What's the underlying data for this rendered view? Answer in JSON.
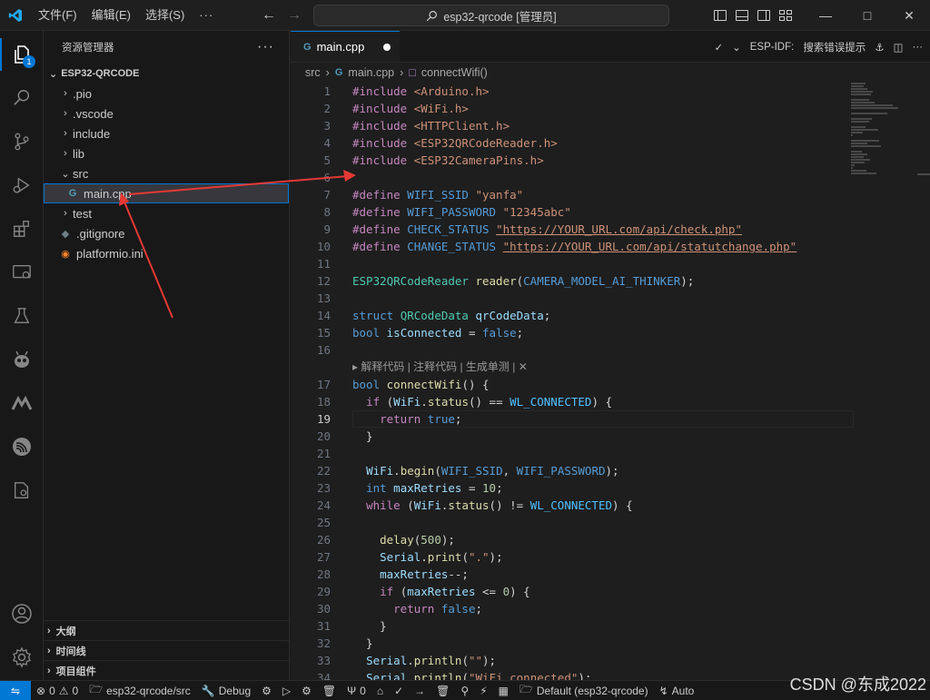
{
  "titlebar": {
    "menus": [
      "文件(F)",
      "编辑(E)",
      "选择(S)",
      "···"
    ],
    "command_center": "esp32-qrcode [管理员]"
  },
  "activitybar": {
    "explorer_badge": "1",
    "accent_color": "#0078d4"
  },
  "sidebar": {
    "title": "资源管理器",
    "project": "ESP32-QRCODE",
    "items": [
      {
        "label": ".pio",
        "type": "folder",
        "expanded": false
      },
      {
        "label": ".vscode",
        "type": "folder",
        "expanded": false
      },
      {
        "label": "include",
        "type": "folder",
        "expanded": false
      },
      {
        "label": "lib",
        "type": "folder",
        "expanded": false
      },
      {
        "label": "src",
        "type": "folder",
        "expanded": true
      },
      {
        "label": "main.cpp",
        "type": "cpp",
        "selected": true
      },
      {
        "label": "test",
        "type": "folder",
        "expanded": false
      },
      {
        "label": ".gitignore",
        "type": "git"
      },
      {
        "label": "platformio.ini",
        "type": "pio"
      }
    ],
    "bottom_sections": [
      "大纲",
      "时间线",
      "项目组件"
    ]
  },
  "editor": {
    "tab_label": "main.cpp",
    "actions_label": "ESP-IDF:",
    "actions_search": "搜索错误提示",
    "breadcrumb": [
      "src",
      "main.cpp",
      "connectWifi()"
    ],
    "codelens": "解释代码 | 注释代码 | 生成单测 | ✕",
    "current_line": 19
  },
  "code": [
    {
      "n": 1,
      "t": [
        [
          "k-pre",
          "#include "
        ],
        [
          "k-str",
          "<Arduino.h>"
        ]
      ]
    },
    {
      "n": 2,
      "t": [
        [
          "k-pre",
          "#include "
        ],
        [
          "k-str",
          "<WiFi.h>"
        ]
      ]
    },
    {
      "n": 3,
      "t": [
        [
          "k-pre",
          "#include "
        ],
        [
          "k-str",
          "<HTTPClient.h>"
        ]
      ]
    },
    {
      "n": 4,
      "t": [
        [
          "k-pre",
          "#include "
        ],
        [
          "k-str",
          "<ESP32QRCodeReader.h>"
        ]
      ]
    },
    {
      "n": 5,
      "t": [
        [
          "k-pre",
          "#include "
        ],
        [
          "k-str",
          "<ESP32CameraPins.h>"
        ]
      ]
    },
    {
      "n": 6,
      "t": []
    },
    {
      "n": 7,
      "t": [
        [
          "k-pre",
          "#define "
        ],
        [
          "k-mac",
          "WIFI_SSID "
        ],
        [
          "k-str",
          "\"yanfa\""
        ]
      ]
    },
    {
      "n": 8,
      "t": [
        [
          "k-pre",
          "#define "
        ],
        [
          "k-mac",
          "WIFI_PASSWORD "
        ],
        [
          "k-str",
          "\"12345abc\""
        ]
      ]
    },
    {
      "n": 9,
      "t": [
        [
          "k-pre",
          "#define "
        ],
        [
          "k-mac",
          "CHECK_STATUS "
        ],
        [
          "k-str",
          "\"https://YOUR_URL.com/api/check.php\""
        ]
      ]
    },
    {
      "n": 10,
      "t": [
        [
          "k-pre",
          "#define "
        ],
        [
          "k-mac",
          "CHANGE_STATUS "
        ],
        [
          "k-str",
          "\"https://YOUR_URL.com/api/statutchange.php\""
        ]
      ]
    },
    {
      "n": 11,
      "t": []
    },
    {
      "n": 12,
      "t": [
        [
          "k-ty",
          "ESP32QRCodeReader "
        ],
        [
          "k-fn",
          "reader"
        ],
        [
          "k-plain",
          "("
        ],
        [
          "k-mac",
          "CAMERA_MODEL_AI_THINKER"
        ],
        [
          "k-plain",
          ");"
        ]
      ]
    },
    {
      "n": 13,
      "t": []
    },
    {
      "n": 14,
      "t": [
        [
          "k-kw",
          "struct "
        ],
        [
          "k-ty",
          "QRCodeData "
        ],
        [
          "k-var",
          "qrCodeData"
        ],
        [
          "k-plain",
          ";"
        ]
      ]
    },
    {
      "n": 15,
      "t": [
        [
          "k-kw",
          "bool "
        ],
        [
          "k-var",
          "isConnected "
        ],
        [
          "k-plain",
          "= "
        ],
        [
          "k-kw",
          "false"
        ],
        [
          "k-plain",
          ";"
        ]
      ]
    },
    {
      "n": 16,
      "t": []
    },
    {
      "n": 17,
      "t": [
        [
          "k-kw",
          "bool "
        ],
        [
          "k-fn",
          "connectWifi"
        ],
        [
          "k-plain",
          "() {"
        ]
      ]
    },
    {
      "n": 18,
      "t": [
        [
          "k-plain",
          "  "
        ],
        [
          "k-pre",
          "if "
        ],
        [
          "k-plain",
          "("
        ],
        [
          "k-var",
          "WiFi"
        ],
        [
          "k-plain",
          "."
        ],
        [
          "k-fn",
          "status"
        ],
        [
          "k-plain",
          "() == "
        ],
        [
          "k-con",
          "WL_CONNECTED"
        ],
        [
          "k-plain",
          ") {"
        ]
      ]
    },
    {
      "n": 19,
      "t": [
        [
          "k-plain",
          "    "
        ],
        [
          "k-pre",
          "return "
        ],
        [
          "k-kw",
          "true"
        ],
        [
          "k-plain",
          ";"
        ]
      ]
    },
    {
      "n": 20,
      "t": [
        [
          "k-plain",
          "  }"
        ]
      ]
    },
    {
      "n": 21,
      "t": []
    },
    {
      "n": 22,
      "t": [
        [
          "k-plain",
          "  "
        ],
        [
          "k-var",
          "WiFi"
        ],
        [
          "k-plain",
          "."
        ],
        [
          "k-fn",
          "begin"
        ],
        [
          "k-plain",
          "("
        ],
        [
          "k-mac",
          "WIFI_SSID"
        ],
        [
          "k-plain",
          ", "
        ],
        [
          "k-mac",
          "WIFI_PASSWORD"
        ],
        [
          "k-plain",
          ");"
        ]
      ]
    },
    {
      "n": 23,
      "t": [
        [
          "k-plain",
          "  "
        ],
        [
          "k-kw",
          "int "
        ],
        [
          "k-var",
          "maxRetries "
        ],
        [
          "k-plain",
          "= "
        ],
        [
          "k-num",
          "10"
        ],
        [
          "k-plain",
          ";"
        ]
      ]
    },
    {
      "n": 24,
      "t": [
        [
          "k-plain",
          "  "
        ],
        [
          "k-pre",
          "while "
        ],
        [
          "k-plain",
          "("
        ],
        [
          "k-var",
          "WiFi"
        ],
        [
          "k-plain",
          "."
        ],
        [
          "k-fn",
          "status"
        ],
        [
          "k-plain",
          "() != "
        ],
        [
          "k-con",
          "WL_CONNECTED"
        ],
        [
          "k-plain",
          ") {"
        ]
      ]
    },
    {
      "n": 25,
      "t": []
    },
    {
      "n": 26,
      "t": [
        [
          "k-plain",
          "    "
        ],
        [
          "k-fn",
          "delay"
        ],
        [
          "k-plain",
          "("
        ],
        [
          "k-num",
          "500"
        ],
        [
          "k-plain",
          ");"
        ]
      ]
    },
    {
      "n": 27,
      "t": [
        [
          "k-plain",
          "    "
        ],
        [
          "k-var",
          "Serial"
        ],
        [
          "k-plain",
          "."
        ],
        [
          "k-fn",
          "print"
        ],
        [
          "k-plain",
          "("
        ],
        [
          "k-str",
          "\".\""
        ],
        [
          "k-plain",
          ");"
        ]
      ]
    },
    {
      "n": 28,
      "t": [
        [
          "k-plain",
          "    "
        ],
        [
          "k-var",
          "maxRetries"
        ],
        [
          "k-plain",
          "--;"
        ]
      ]
    },
    {
      "n": 29,
      "t": [
        [
          "k-plain",
          "    "
        ],
        [
          "k-pre",
          "if "
        ],
        [
          "k-plain",
          "("
        ],
        [
          "k-var",
          "maxRetries "
        ],
        [
          "k-plain",
          "<= "
        ],
        [
          "k-num",
          "0"
        ],
        [
          "k-plain",
          ") {"
        ]
      ]
    },
    {
      "n": 30,
      "t": [
        [
          "k-plain",
          "      "
        ],
        [
          "k-pre",
          "return "
        ],
        [
          "k-kw",
          "false"
        ],
        [
          "k-plain",
          ";"
        ]
      ]
    },
    {
      "n": 31,
      "t": [
        [
          "k-plain",
          "    }"
        ]
      ]
    },
    {
      "n": 32,
      "t": [
        [
          "k-plain",
          "  }"
        ]
      ]
    },
    {
      "n": 33,
      "t": [
        [
          "k-plain",
          "  "
        ],
        [
          "k-var",
          "Serial"
        ],
        [
          "k-plain",
          "."
        ],
        [
          "k-fn",
          "println"
        ],
        [
          "k-plain",
          "("
        ],
        [
          "k-str",
          "\"\""
        ],
        [
          "k-plain",
          ");"
        ]
      ]
    },
    {
      "n": 34,
      "t": [
        [
          "k-plain",
          "  "
        ],
        [
          "k-var",
          "Serial"
        ],
        [
          "k-plain",
          "."
        ],
        [
          "k-fn",
          "println"
        ],
        [
          "k-plain",
          "("
        ],
        [
          "k-str",
          "\"WiFi connected\""
        ],
        [
          "k-plain",
          ");"
        ]
      ]
    }
  ],
  "statusbar": {
    "errors": "0",
    "warnings": "0",
    "folder": "esp32-qrcode/src",
    "debug": "Debug",
    "ports": "0",
    "env": "Default (esp32-qrcode)",
    "auto": "Auto"
  },
  "watermark": "CSDN @东成2022"
}
